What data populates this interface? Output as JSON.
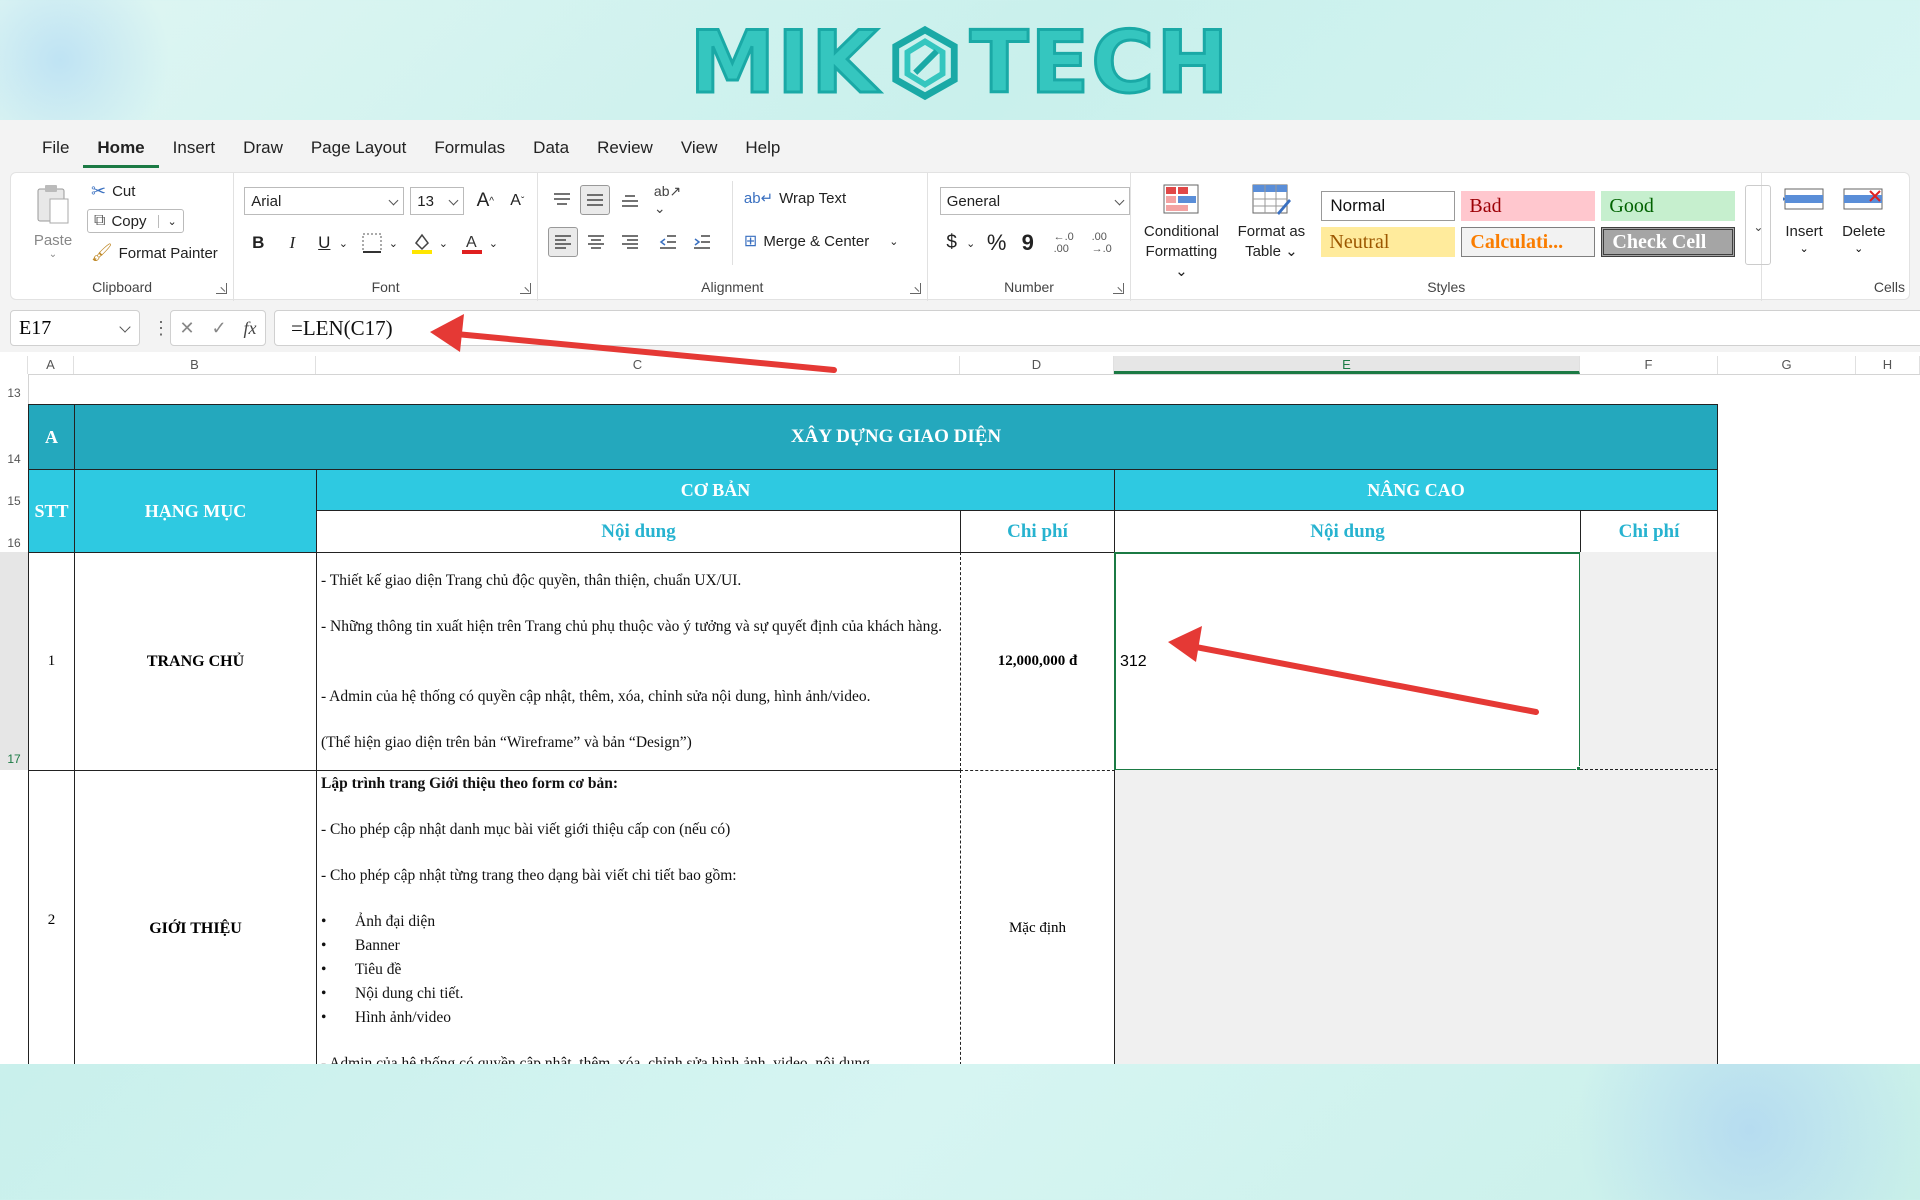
{
  "logo": {
    "left": "MIK",
    "right": "TECH"
  },
  "menu": [
    "File",
    "Home",
    "Insert",
    "Draw",
    "Page Layout",
    "Formulas",
    "Data",
    "Review",
    "View",
    "Help"
  ],
  "clipboard": {
    "paste": "Paste",
    "cut": "Cut",
    "copy": "Copy",
    "format_painter": "Format Painter",
    "label": "Clipboard"
  },
  "font": {
    "family": "Arial",
    "size": "13",
    "label": "Font",
    "bold": "B",
    "italic": "I",
    "underline": "U"
  },
  "alignment": {
    "wrap": "Wrap Text",
    "merge": "Merge & Center",
    "label": "Alignment"
  },
  "number": {
    "format": "General",
    "label": "Number"
  },
  "styles": {
    "conditional": [
      "Conditional",
      "Formatting"
    ],
    "format_table": [
      "Format as",
      "Table"
    ],
    "normal": "Normal",
    "bad": "Bad",
    "good": "Good",
    "neutral": "Neutral",
    "calculation": "Calculati...",
    "check": "Check Cell",
    "label": "Styles"
  },
  "cells": {
    "insert": "Insert",
    "delete": "Delete",
    "label": "Cells"
  },
  "formula_bar": {
    "name_box": "E17",
    "formula": "=LEN(C17)"
  },
  "columns": [
    "A",
    "B",
    "C",
    "D",
    "E",
    "F",
    "G",
    "H"
  ],
  "rows": [
    "13",
    "14",
    "15",
    "16",
    "17"
  ],
  "table": {
    "section_code": "A",
    "section_title": "XÂY DỰNG GIAO DIỆN",
    "stt": "STT",
    "hang_muc": "HẠNG MỤC",
    "co_ban": "CƠ BẢN",
    "nang_cao": "NÂNG CAO",
    "noi_dung": "Nội dung",
    "chi_phi": "Chi phí",
    "row1": {
      "stt": "1",
      "name": "TRANG CHỦ",
      "lines": [
        "- Thiết kế giao diện Trang chủ độc quyền, thân thiện, chuẩn UX/UI.",
        "- Những thông tin xuất hiện trên Trang chủ phụ thuộc vào ý tưởng và sự quyết định của khách hàng.",
        "- Admin của hệ thống có quyền cập nhật, thêm, xóa, chỉnh sửa nội dung, hình ảnh/video.",
        "(Thể hiện giao diện trên bản “Wireframe” và bản “Design”)"
      ],
      "price": "12,000,000 đ",
      "len_result": "312"
    },
    "row2": {
      "stt": "2",
      "name": "GIỚI THIỆU",
      "heading": "Lập trình trang Giới thiệu theo form cơ bản:",
      "lines": [
        "- Cho phép cập nhật danh mục bài viết giới thiệu cấp con (nếu có)",
        "- Cho phép cập nhật từng trang theo dạng bài viết chi tiết bao gồm:"
      ],
      "bullets": [
        "Ảnh đại diện",
        "Banner",
        "Tiêu đề",
        "Nội dung chi tiết.",
        "Hình ảnh/video"
      ],
      "cut_line": "- Admin của hệ thống có quyền cập nhật, thêm, xóa, chỉnh sửa hình ảnh, video, nội dung",
      "price": "Mặc định"
    }
  }
}
